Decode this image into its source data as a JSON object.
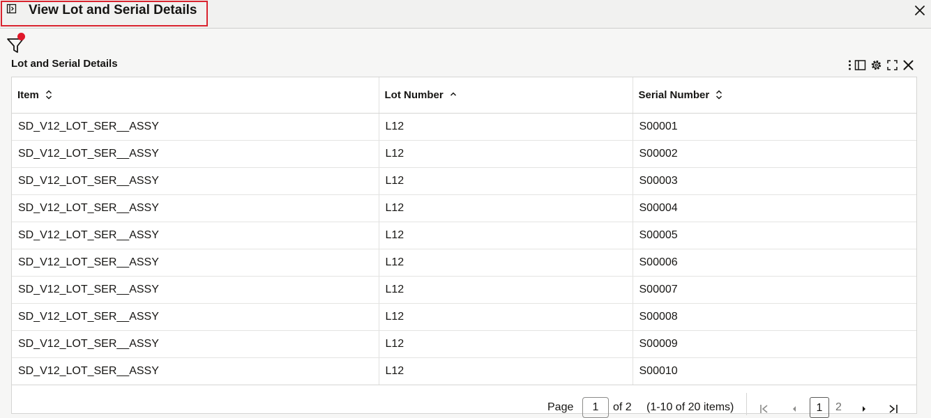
{
  "window": {
    "title": "View Lot and Serial Details"
  },
  "section": {
    "title": "Lot and Serial Details"
  },
  "table": {
    "columns": [
      {
        "label": "Item",
        "sort": "none"
      },
      {
        "label": "Lot Number",
        "sort": "ascending"
      },
      {
        "label": "Serial Number",
        "sort": "none"
      }
    ],
    "rows": [
      [
        "SD_V12_LOT_SER__ASSY",
        "L12",
        "S00001"
      ],
      [
        "SD_V12_LOT_SER__ASSY",
        "L12",
        "S00002"
      ],
      [
        "SD_V12_LOT_SER__ASSY",
        "L12",
        "S00003"
      ],
      [
        "SD_V12_LOT_SER__ASSY",
        "L12",
        "S00004"
      ],
      [
        "SD_V12_LOT_SER__ASSY",
        "L12",
        "S00005"
      ],
      [
        "SD_V12_LOT_SER__ASSY",
        "L12",
        "S00006"
      ],
      [
        "SD_V12_LOT_SER__ASSY",
        "L12",
        "S00007"
      ],
      [
        "SD_V12_LOT_SER__ASSY",
        "L12",
        "S00008"
      ],
      [
        "SD_V12_LOT_SER__ASSY",
        "L12",
        "S00009"
      ],
      [
        "SD_V12_LOT_SER__ASSY",
        "L12",
        "S00010"
      ]
    ]
  },
  "pagination": {
    "page_label": "Page",
    "current_page": "1",
    "of_label": "of 2",
    "range_label": "(1-10 of 20 items)",
    "pages": [
      "1",
      "2"
    ]
  },
  "icons": {
    "toolbar": [
      "more-options-icon",
      "panel-toggle-icon",
      "settings-gear-icon",
      "expand-icon",
      "close-icon"
    ],
    "filter": "filter-icon",
    "title": "panel-expand-icon"
  },
  "colors": {
    "highlight_border": "#d9232e",
    "filter_badge": "#e0182a"
  }
}
